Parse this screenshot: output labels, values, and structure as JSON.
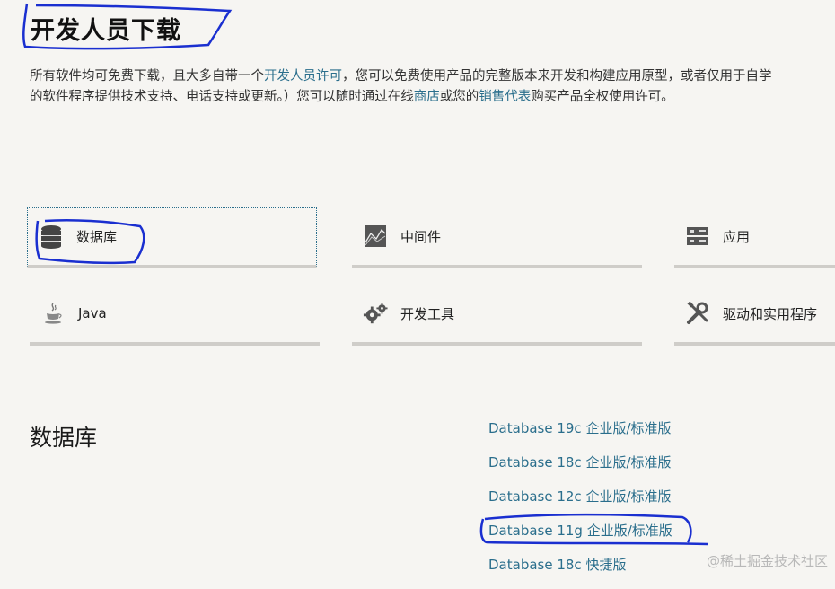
{
  "page": {
    "title": "开发人员下载",
    "intro": {
      "p1_pre": "所有软件均可免费下载，且大多自带一个",
      "p1_link": "开发人员许可",
      "p1_post": "，您可以免费使用产品的完整版本来开发和构建应用原型，或者仅用于自学",
      "p2_pre": "的软件程序提供技术支持、电话支持或更新。）您可以随时通过在线",
      "p2_link_store": "商店",
      "p2_mid": "或您的",
      "p2_link_sales": "销售代表",
      "p2_post": "购买产品全权使用许可。"
    }
  },
  "categories": [
    {
      "label": "数据库",
      "icon": "database-icon",
      "active": true
    },
    {
      "label": "中间件",
      "icon": "middleware-icon"
    },
    {
      "label": "应用",
      "icon": "server-icon"
    },
    {
      "label": "Java",
      "icon": "java-cup-icon"
    },
    {
      "label": "开发工具",
      "icon": "gears-icon"
    },
    {
      "label": "驱动和实用程序",
      "icon": "tools-icon"
    }
  ],
  "section": {
    "title": "数据库",
    "links": [
      "Database 19c 企业版/标准版",
      "Database 18c 企业版/标准版",
      "Database 12c 企业版/标准版",
      "Database 11g 企业版/标准版",
      "Database 18c 快捷版"
    ]
  },
  "watermark": "@稀土掘金技术社区",
  "colors": {
    "accent": "#2a6e8c",
    "annotation": "#1a2fd0",
    "background": "#f6f5f2"
  }
}
